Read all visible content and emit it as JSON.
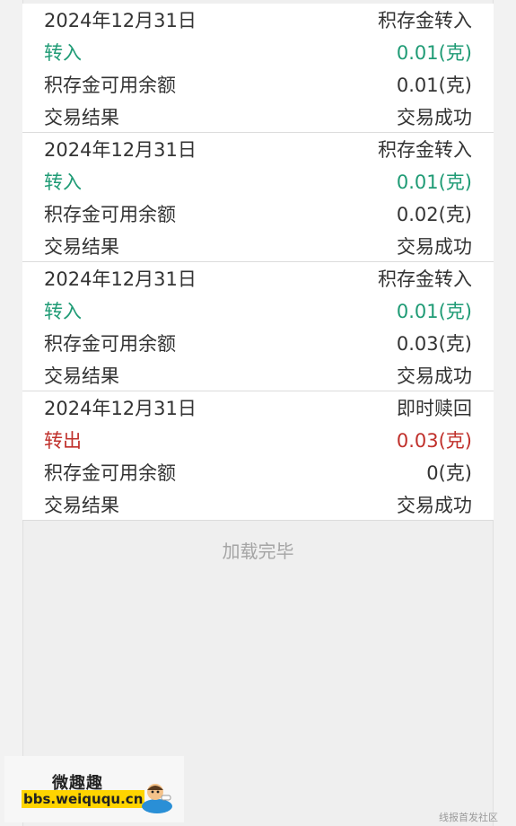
{
  "colors": {
    "in": "#1f9b75",
    "out": "#c0302b",
    "text": "#333333",
    "muted": "#a5a5a5"
  },
  "records": [
    {
      "date": "2024年12月31日",
      "type": "积存金转入",
      "direction": "转入",
      "amount": "0.01(克)",
      "direction_kind": "in",
      "balance_label": "积存金可用余额",
      "balance": "0.01(克)",
      "result_label": "交易结果",
      "result": "交易成功"
    },
    {
      "date": "2024年12月31日",
      "type": "积存金转入",
      "direction": "转入",
      "amount": "0.01(克)",
      "direction_kind": "in",
      "balance_label": "积存金可用余额",
      "balance": "0.02(克)",
      "result_label": "交易结果",
      "result": "交易成功"
    },
    {
      "date": "2024年12月31日",
      "type": "积存金转入",
      "direction": "转入",
      "amount": "0.01(克)",
      "direction_kind": "in",
      "balance_label": "积存金可用余额",
      "balance": "0.03(克)",
      "result_label": "交易结果",
      "result": "交易成功"
    },
    {
      "date": "2024年12月31日",
      "type": "即时赎回",
      "direction": "转出",
      "amount": "0.03(克)",
      "direction_kind": "out",
      "balance_label": "积存金可用余额",
      "balance": "0(克)",
      "result_label": "交易结果",
      "result": "交易成功"
    }
  ],
  "footer": {
    "load_complete": "加载完毕"
  },
  "watermark": {
    "site_name": "微趣趣",
    "url": "bbs.weiququ.cn",
    "corner": "线报首发社区"
  }
}
